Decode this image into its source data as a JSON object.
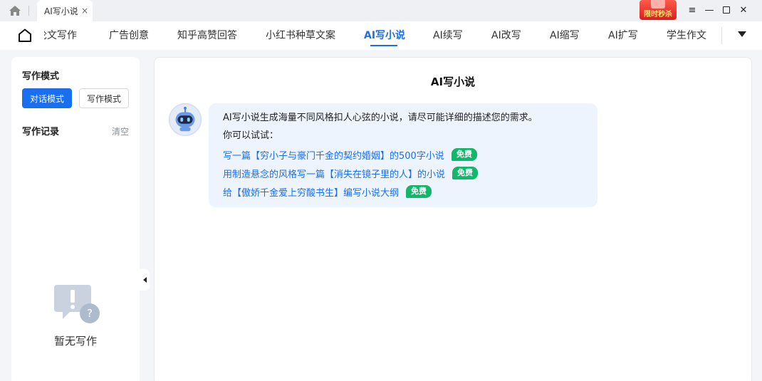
{
  "titlebar": {
    "tab_title": "AI写小说",
    "tab_close": "×",
    "promo_label": "限时秒杀",
    "menu_glyph": "≡",
    "minimize_glyph": "—",
    "close_glyph": "✕"
  },
  "nav": {
    "items": [
      "论文写作",
      "广告创意",
      "知乎高赞回答",
      "小红书种草文案",
      "AI写小说",
      "AI续写",
      "AI改写",
      "AI缩写",
      "AI扩写",
      "学生作文"
    ],
    "active": "AI写小说"
  },
  "left_panel": {
    "mode_title": "写作模式",
    "modes": [
      "对话模式",
      "写作模式"
    ],
    "active_mode": "对话模式",
    "record_title": "写作记录",
    "clear_label": "清空",
    "empty_text": "暂无写作"
  },
  "main": {
    "title": "AI写小说",
    "intro": "AI写小说生成海量不同风格扣人心弦的小说，请尽可能详细的描述您的需求。",
    "try_label": "你可以试试：",
    "suggestions": [
      "写一篇【穷小子与豪门千金的契约婚姻】的500字小说",
      "用制造悬念的风格写一篇【消失在镜子里的人】的小说",
      "给【傲娇千金爱上穷酸书生】编写小说大纲"
    ],
    "free_badge": "免费"
  },
  "colors": {
    "accent": "#1a6ef0",
    "free_badge": "#12b76a",
    "bubble_bg": "#eef4fd"
  }
}
